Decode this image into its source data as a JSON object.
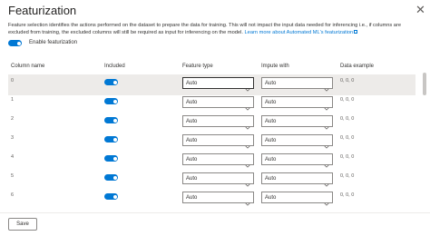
{
  "panel": {
    "title": "Featurization",
    "close_glyph": "✕"
  },
  "description": {
    "text": "Feature selection identifies the actions performed on the dataset to prepare the data for training. This will not impact the input data needed for inferencing i.e., if columns are excluded from training, the excluded columns will still be required as input for inferencing on the model.",
    "link_text": "Learn more about Automated ML's featurization"
  },
  "enable_featurization": {
    "label": "Enable featurization",
    "on": true
  },
  "table": {
    "headers": {
      "column_name": "Column name",
      "included": "Included",
      "feature_type": "Feature type",
      "impute_with": "Impute with",
      "data_example": "Data example"
    },
    "rows": [
      {
        "name": "0",
        "included": true,
        "feature_type": "Auto",
        "impute_with": "Auto",
        "example": "0, 0, 0",
        "selected": true
      },
      {
        "name": "1",
        "included": true,
        "feature_type": "Auto",
        "impute_with": "Auto",
        "example": "0, 0, 0",
        "selected": false
      },
      {
        "name": "2",
        "included": true,
        "feature_type": "Auto",
        "impute_with": "Auto",
        "example": "0, 0, 0",
        "selected": false
      },
      {
        "name": "3",
        "included": true,
        "feature_type": "Auto",
        "impute_with": "Auto",
        "example": "0, 0, 0",
        "selected": false
      },
      {
        "name": "4",
        "included": true,
        "feature_type": "Auto",
        "impute_with": "Auto",
        "example": "0, 0, 0",
        "selected": false
      },
      {
        "name": "5",
        "included": true,
        "feature_type": "Auto",
        "impute_with": "Auto",
        "example": "0, 0, 0",
        "selected": false
      },
      {
        "name": "6",
        "included": true,
        "feature_type": "Auto",
        "impute_with": "Auto",
        "example": "0, 0, 0",
        "selected": false
      }
    ]
  },
  "footer": {
    "save_label": "Save"
  },
  "colors": {
    "accent": "#0078d4",
    "selected_row": "#edebe9",
    "border": "#8a8886"
  }
}
